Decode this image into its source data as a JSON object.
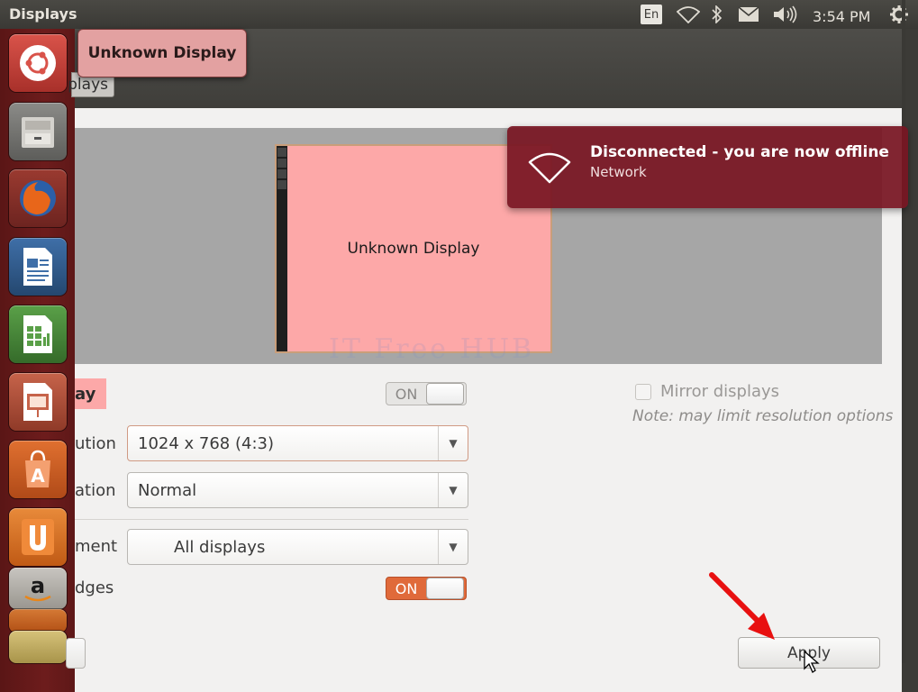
{
  "top_panel": {
    "title": "Displays",
    "language": "En",
    "clock": "3:54 PM",
    "icons": [
      "wifi-icon",
      "bluetooth-icon",
      "mail-icon",
      "volume-icon",
      "gear-icon"
    ]
  },
  "launcher": {
    "items": [
      "Dash Home",
      "Files",
      "Firefox Web Browser",
      "LibreOffice Writer",
      "LibreOffice Calc",
      "LibreOffice Impress",
      "Ubuntu Software Center",
      "Ubuntu One",
      "Amazon"
    ]
  },
  "tooltip": {
    "text": "Unknown Display"
  },
  "window": {
    "tab_label": "plays",
    "preview": {
      "monitor_label": "Unknown Display",
      "watermark": "IT Free HUB"
    },
    "display_name_badge": "ay",
    "display_toggle": {
      "label": "ON",
      "state": "off"
    },
    "resolution": {
      "label": "ution",
      "value": "1024 x 768 (4:3)"
    },
    "rotation": {
      "label": "ation",
      "value": "Normal"
    },
    "launcher_placement": {
      "label": "ment",
      "value": "All displays"
    },
    "sticky_edges": {
      "label": "dges",
      "toggle_label": "ON",
      "state": "on"
    },
    "mirror": {
      "label": "Mirror displays",
      "checked": false,
      "note": "Note: may limit resolution options"
    },
    "apply_label": "Apply"
  },
  "notification": {
    "title": "Disconnected - you are now offline",
    "body": "Network"
  },
  "colors": {
    "accent_orange": "#e06a3a",
    "launcher_bg": "#6d1c1c",
    "monitor_fill": "#fda8a8",
    "notification_bg": "#78162a",
    "arrow_red": "#e81010"
  }
}
